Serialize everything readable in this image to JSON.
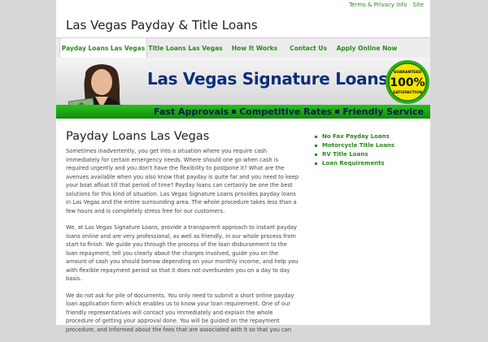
{
  "top_links": [
    "Terms & Privacy Info",
    "Site"
  ],
  "site_title": "Las Vegas Payday & Title Loans",
  "nav": [
    "Payday Loans Las Vegas",
    "Title Loans Las Vegas",
    "How It Works",
    "Contact Us",
    "Apply Online Now"
  ],
  "banner": {
    "title": "Las Vegas Signature Loans",
    "seal_text": [
      "GUARANTEED",
      "100%",
      "SATISFACTION"
    ],
    "bar_items": [
      "Fast Approvals",
      "Competitive Rates",
      "Friendly Service"
    ]
  },
  "content": {
    "heading": "Payday Loans Las Vegas",
    "paragraphs": [
      "Sometimes inadvertently, you get into a situation where you require cash immediately for certain emergency needs. Where should one go when cash is required urgently and you don't have the flexibility to postpone it? What are the avenues available when you also know that payday is quite far and you need to keep your boat afloat till that period of time? Payday loans can certainly be one the best solutions for this kind of situation. Las Vegas Signature Loans provides payday loans in Las Vegas and the entire surrounding area. The whole procedure takes less than a few hours and is completely stress free for our customers.",
      "We, at Las Vegas Signature Loans, provide a transparent approach to instant payday loans online and are very professional, as well as friendly, in our whole process from start to finish. We guide you through the process of the loan disbursement to the loan repayment, tell you clearly about the charges involved, guide you on the amount of cash you should borrow depending on your monthly income, and help you with flexible repayment period so that it does not overburden you on a day to day basis.",
      "We do not ask for pile of documents. You only need to submit a short online payday loan application form which enables us to know your loan requirement. One of our friendly representatives will contact you immediately and explain the whole procedure of getting your approval done. You will be guided on the repayment procedure, and informed about the fees that are associated with it so that you can"
    ]
  },
  "sidebar_links": [
    "No Fax Payday Loans",
    "Motorcycle Title Loans",
    "RV Title Loans",
    "Loan Requirements"
  ]
}
